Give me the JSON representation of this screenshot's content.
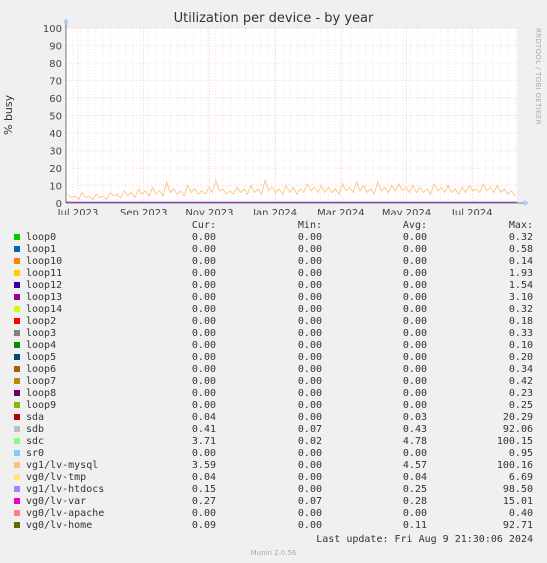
{
  "chart_data": {
    "type": "line",
    "title": "Utilization per device - by year",
    "ylabel": "% busy",
    "ylim": [
      0,
      100
    ],
    "yticks": [
      "0",
      "10",
      "20",
      "30",
      "40",
      "50",
      "60",
      "70",
      "80",
      "90",
      "100"
    ],
    "xticks": [
      "Jul 2023",
      "Sep 2023",
      "Nov 2023",
      "Jan 2024",
      "Mar 2024",
      "May 2024",
      "Jul 2024"
    ],
    "grid": true,
    "side_label": "RRDTOOL / TOBI OETIKER",
    "highlight_series": "vg1/lv-mysql",
    "series_points": [
      5,
      3,
      4,
      2,
      6,
      3,
      4,
      2,
      5,
      3,
      4,
      2,
      6,
      4,
      5,
      3,
      7,
      4,
      6,
      3,
      8,
      5,
      7,
      4,
      9,
      5,
      7,
      4,
      12,
      6,
      8,
      5,
      7,
      4,
      10,
      6,
      8,
      5,
      7,
      5,
      9,
      6,
      13,
      7,
      8,
      5,
      7,
      5,
      9,
      6,
      8,
      5,
      10,
      6,
      8,
      5,
      13,
      7,
      9,
      6,
      8,
      5,
      10,
      6,
      9,
      5,
      8,
      6,
      11,
      7,
      9,
      6,
      10,
      6,
      9,
      6,
      8,
      5,
      11,
      7,
      9,
      6,
      12,
      7,
      10,
      6,
      8,
      5,
      12,
      7,
      9,
      6,
      10,
      7,
      11,
      7,
      9,
      6,
      10,
      6,
      9,
      6,
      8,
      5,
      11,
      7,
      9,
      6,
      10,
      6,
      8,
      5,
      9,
      6,
      10,
      7,
      8,
      6,
      11,
      7,
      9,
      6,
      10,
      6,
      8,
      5,
      7,
      4
    ]
  },
  "legend": {
    "headers": {
      "cur": "Cur:",
      "min": "Min:",
      "avg": "Avg:",
      "max": "Max:"
    },
    "rows": [
      {
        "name": "loop0",
        "color": "#00cc00",
        "cur": "0.00",
        "min": "0.00",
        "avg": "0.00",
        "max": "0.32"
      },
      {
        "name": "loop1",
        "color": "#0066b3",
        "cur": "0.00",
        "min": "0.00",
        "avg": "0.00",
        "max": "0.58"
      },
      {
        "name": "loop10",
        "color": "#ff8000",
        "cur": "0.00",
        "min": "0.00",
        "avg": "0.00",
        "max": "0.14"
      },
      {
        "name": "loop11",
        "color": "#ffcc00",
        "cur": "0.00",
        "min": "0.00",
        "avg": "0.00",
        "max": "1.93"
      },
      {
        "name": "loop12",
        "color": "#330099",
        "cur": "0.00",
        "min": "0.00",
        "avg": "0.00",
        "max": "1.54"
      },
      {
        "name": "loop13",
        "color": "#990099",
        "cur": "0.00",
        "min": "0.00",
        "avg": "0.00",
        "max": "3.10"
      },
      {
        "name": "loop14",
        "color": "#ccff00",
        "cur": "0.00",
        "min": "0.00",
        "avg": "0.00",
        "max": "0.32"
      },
      {
        "name": "loop2",
        "color": "#ff0000",
        "cur": "0.00",
        "min": "0.00",
        "avg": "0.00",
        "max": "0.18"
      },
      {
        "name": "loop3",
        "color": "#808080",
        "cur": "0.00",
        "min": "0.00",
        "avg": "0.00",
        "max": "0.33"
      },
      {
        "name": "loop4",
        "color": "#008f00",
        "cur": "0.00",
        "min": "0.00",
        "avg": "0.00",
        "max": "0.10"
      },
      {
        "name": "loop5",
        "color": "#00487d",
        "cur": "0.00",
        "min": "0.00",
        "avg": "0.00",
        "max": "0.20"
      },
      {
        "name": "loop6",
        "color": "#b35a00",
        "cur": "0.00",
        "min": "0.00",
        "avg": "0.00",
        "max": "0.34"
      },
      {
        "name": "loop7",
        "color": "#b38f00",
        "cur": "0.00",
        "min": "0.00",
        "avg": "0.00",
        "max": "0.42"
      },
      {
        "name": "loop8",
        "color": "#6b006b",
        "cur": "0.00",
        "min": "0.00",
        "avg": "0.00",
        "max": "0.23"
      },
      {
        "name": "loop9",
        "color": "#8fb300",
        "cur": "0.00",
        "min": "0.00",
        "avg": "0.00",
        "max": "0.25"
      },
      {
        "name": "sda",
        "color": "#b30000",
        "cur": "0.04",
        "min": "0.00",
        "avg": "0.03",
        "max": "20.29"
      },
      {
        "name": "sdb",
        "color": "#bebebe",
        "cur": "0.41",
        "min": "0.07",
        "avg": "0.43",
        "max": "92.06"
      },
      {
        "name": "sdc",
        "color": "#80ff80",
        "cur": "3.71",
        "min": "0.02",
        "avg": "4.78",
        "max": "100.15"
      },
      {
        "name": "sr0",
        "color": "#80c9ff",
        "cur": "0.00",
        "min": "0.00",
        "avg": "0.00",
        "max": "0.95"
      },
      {
        "name": "vg1/lv-mysql",
        "color": "#ffc080",
        "cur": "3.59",
        "min": "0.00",
        "avg": "4.57",
        "max": "100.16"
      },
      {
        "name": "vg0/lv-tmp",
        "color": "#ffe680",
        "cur": "0.04",
        "min": "0.00",
        "avg": "0.04",
        "max": "6.69"
      },
      {
        "name": "vg1/lv-htdocs",
        "color": "#aa80ff",
        "cur": "0.15",
        "min": "0.00",
        "avg": "0.25",
        "max": "98.50"
      },
      {
        "name": "vg0/lv-var",
        "color": "#ee00cc",
        "cur": "0.27",
        "min": "0.07",
        "avg": "0.28",
        "max": "15.01"
      },
      {
        "name": "vg0/lv-apache",
        "color": "#ff8080",
        "cur": "0.00",
        "min": "0.00",
        "avg": "0.00",
        "max": "0.40"
      },
      {
        "name": "vg0/lv-home",
        "color": "#666600",
        "cur": "0.09",
        "min": "0.00",
        "avg": "0.11",
        "max": "92.71"
      }
    ]
  },
  "footer": {
    "last_update": "Last update: Fri Aug  9 21:30:06 2024",
    "version": "Munin 2.0.56"
  }
}
